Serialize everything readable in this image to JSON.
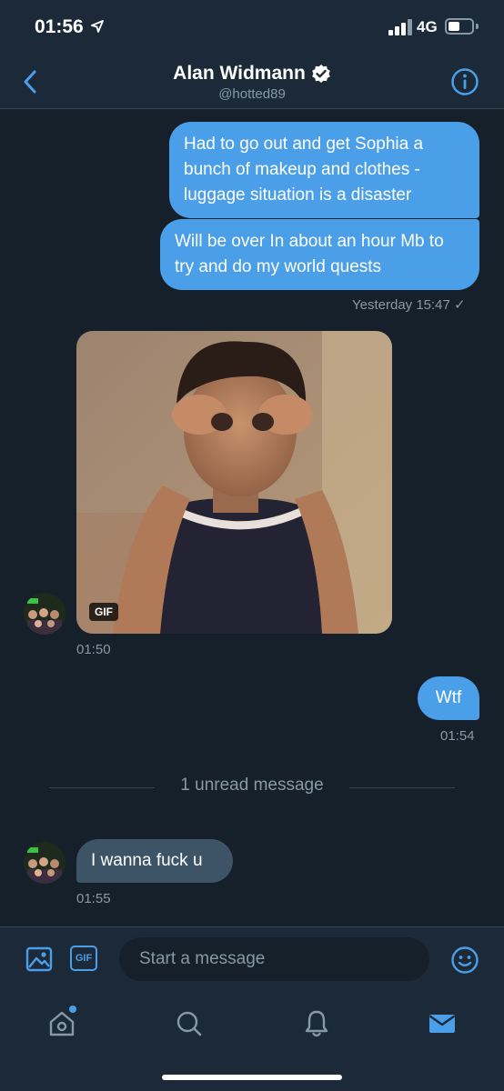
{
  "status_bar": {
    "time": "01:56",
    "network": "4G"
  },
  "header": {
    "name": "Alan Widmann",
    "handle": "@hotted89"
  },
  "conversation": {
    "sent_1": "Had to go out and get Sophia a bunch of makeup and clothes - luggage situation is a disaster",
    "sent_2": "Will be over In about an hour Mb to try and do my world quests",
    "sent_time": "Yesterday 15:47 ✓",
    "gif_badge": "GIF",
    "gif_time": "01:50",
    "sent_3": "Wtf",
    "sent_3_time": "01:54",
    "unread_label": "1 unread message",
    "received_1": "I wanna fuck u",
    "received_1_time": "01:55"
  },
  "composer": {
    "gif_label": "GIF",
    "placeholder": "Start a message"
  },
  "colors": {
    "accent": "#4a9fe8",
    "background": "#15202b",
    "surface": "#1c2938",
    "received_bubble": "#3d5466"
  },
  "icons": [
    "location-arrow-icon",
    "signal-icon",
    "battery-icon",
    "back-chevron-icon",
    "verified-badge-icon",
    "info-icon",
    "image-icon",
    "gif-icon",
    "emoji-icon",
    "home-icon",
    "search-icon",
    "bell-icon",
    "mail-icon"
  ]
}
